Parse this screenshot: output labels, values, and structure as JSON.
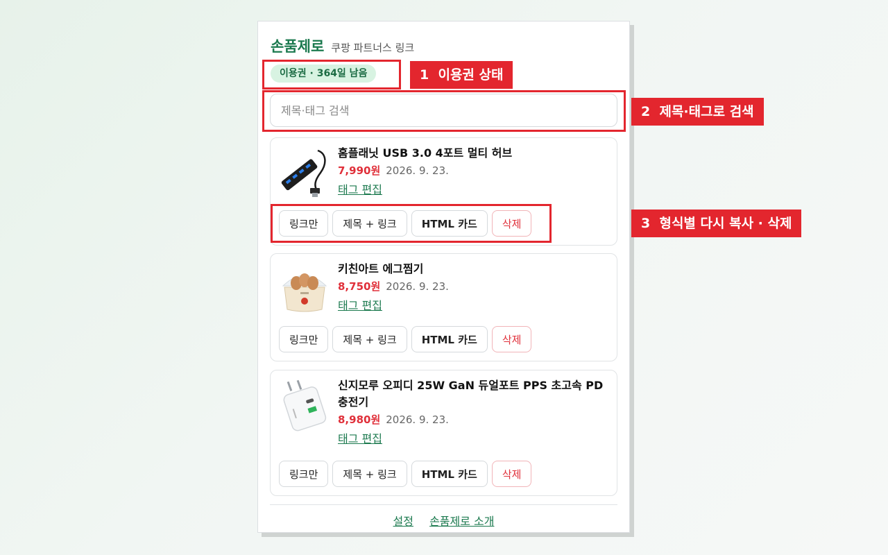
{
  "app": {
    "title": "손품제로",
    "subtitle": "쿠팡 파트너스 링크",
    "license_badge": "이용권 · 364일 남음"
  },
  "search": {
    "placeholder": "제목·태그 검색",
    "value": ""
  },
  "items": [
    {
      "name": "홈플래닛 USB 3.0 4포트 멀티 허브",
      "price": "7,990원",
      "date": "2026. 9. 23.",
      "tag_edit": "태그 편집",
      "thumb_icon": "usb-hub-icon"
    },
    {
      "name": "키친아트 에그찜기",
      "price": "8,750원",
      "date": "2026. 9. 23.",
      "tag_edit": "태그 편집",
      "thumb_icon": "egg-steamer-icon"
    },
    {
      "name": "신지모루 오피디 25W GaN 듀얼포트 PPS 초고속 PD 충전기",
      "price": "8,980원",
      "date": "2026. 9. 23.",
      "tag_edit": "태그 편집",
      "thumb_icon": "charger-icon"
    }
  ],
  "actions": {
    "link_only": "링크만",
    "title_link": "제목 + 링크",
    "html_card": "HTML 카드",
    "delete": "삭제"
  },
  "footer": {
    "settings": "설정",
    "about": "손품제로 소개"
  },
  "callouts": [
    {
      "number": "1",
      "text": "이용권 상태"
    },
    {
      "number": "2",
      "text": "제목·태그로 검색"
    },
    {
      "number": "3",
      "text": "형식별 다시 복사 · 삭제"
    }
  ],
  "colors": {
    "accent": "#1c7a4f",
    "price": "#e0303a",
    "callout": "#e3262e"
  }
}
